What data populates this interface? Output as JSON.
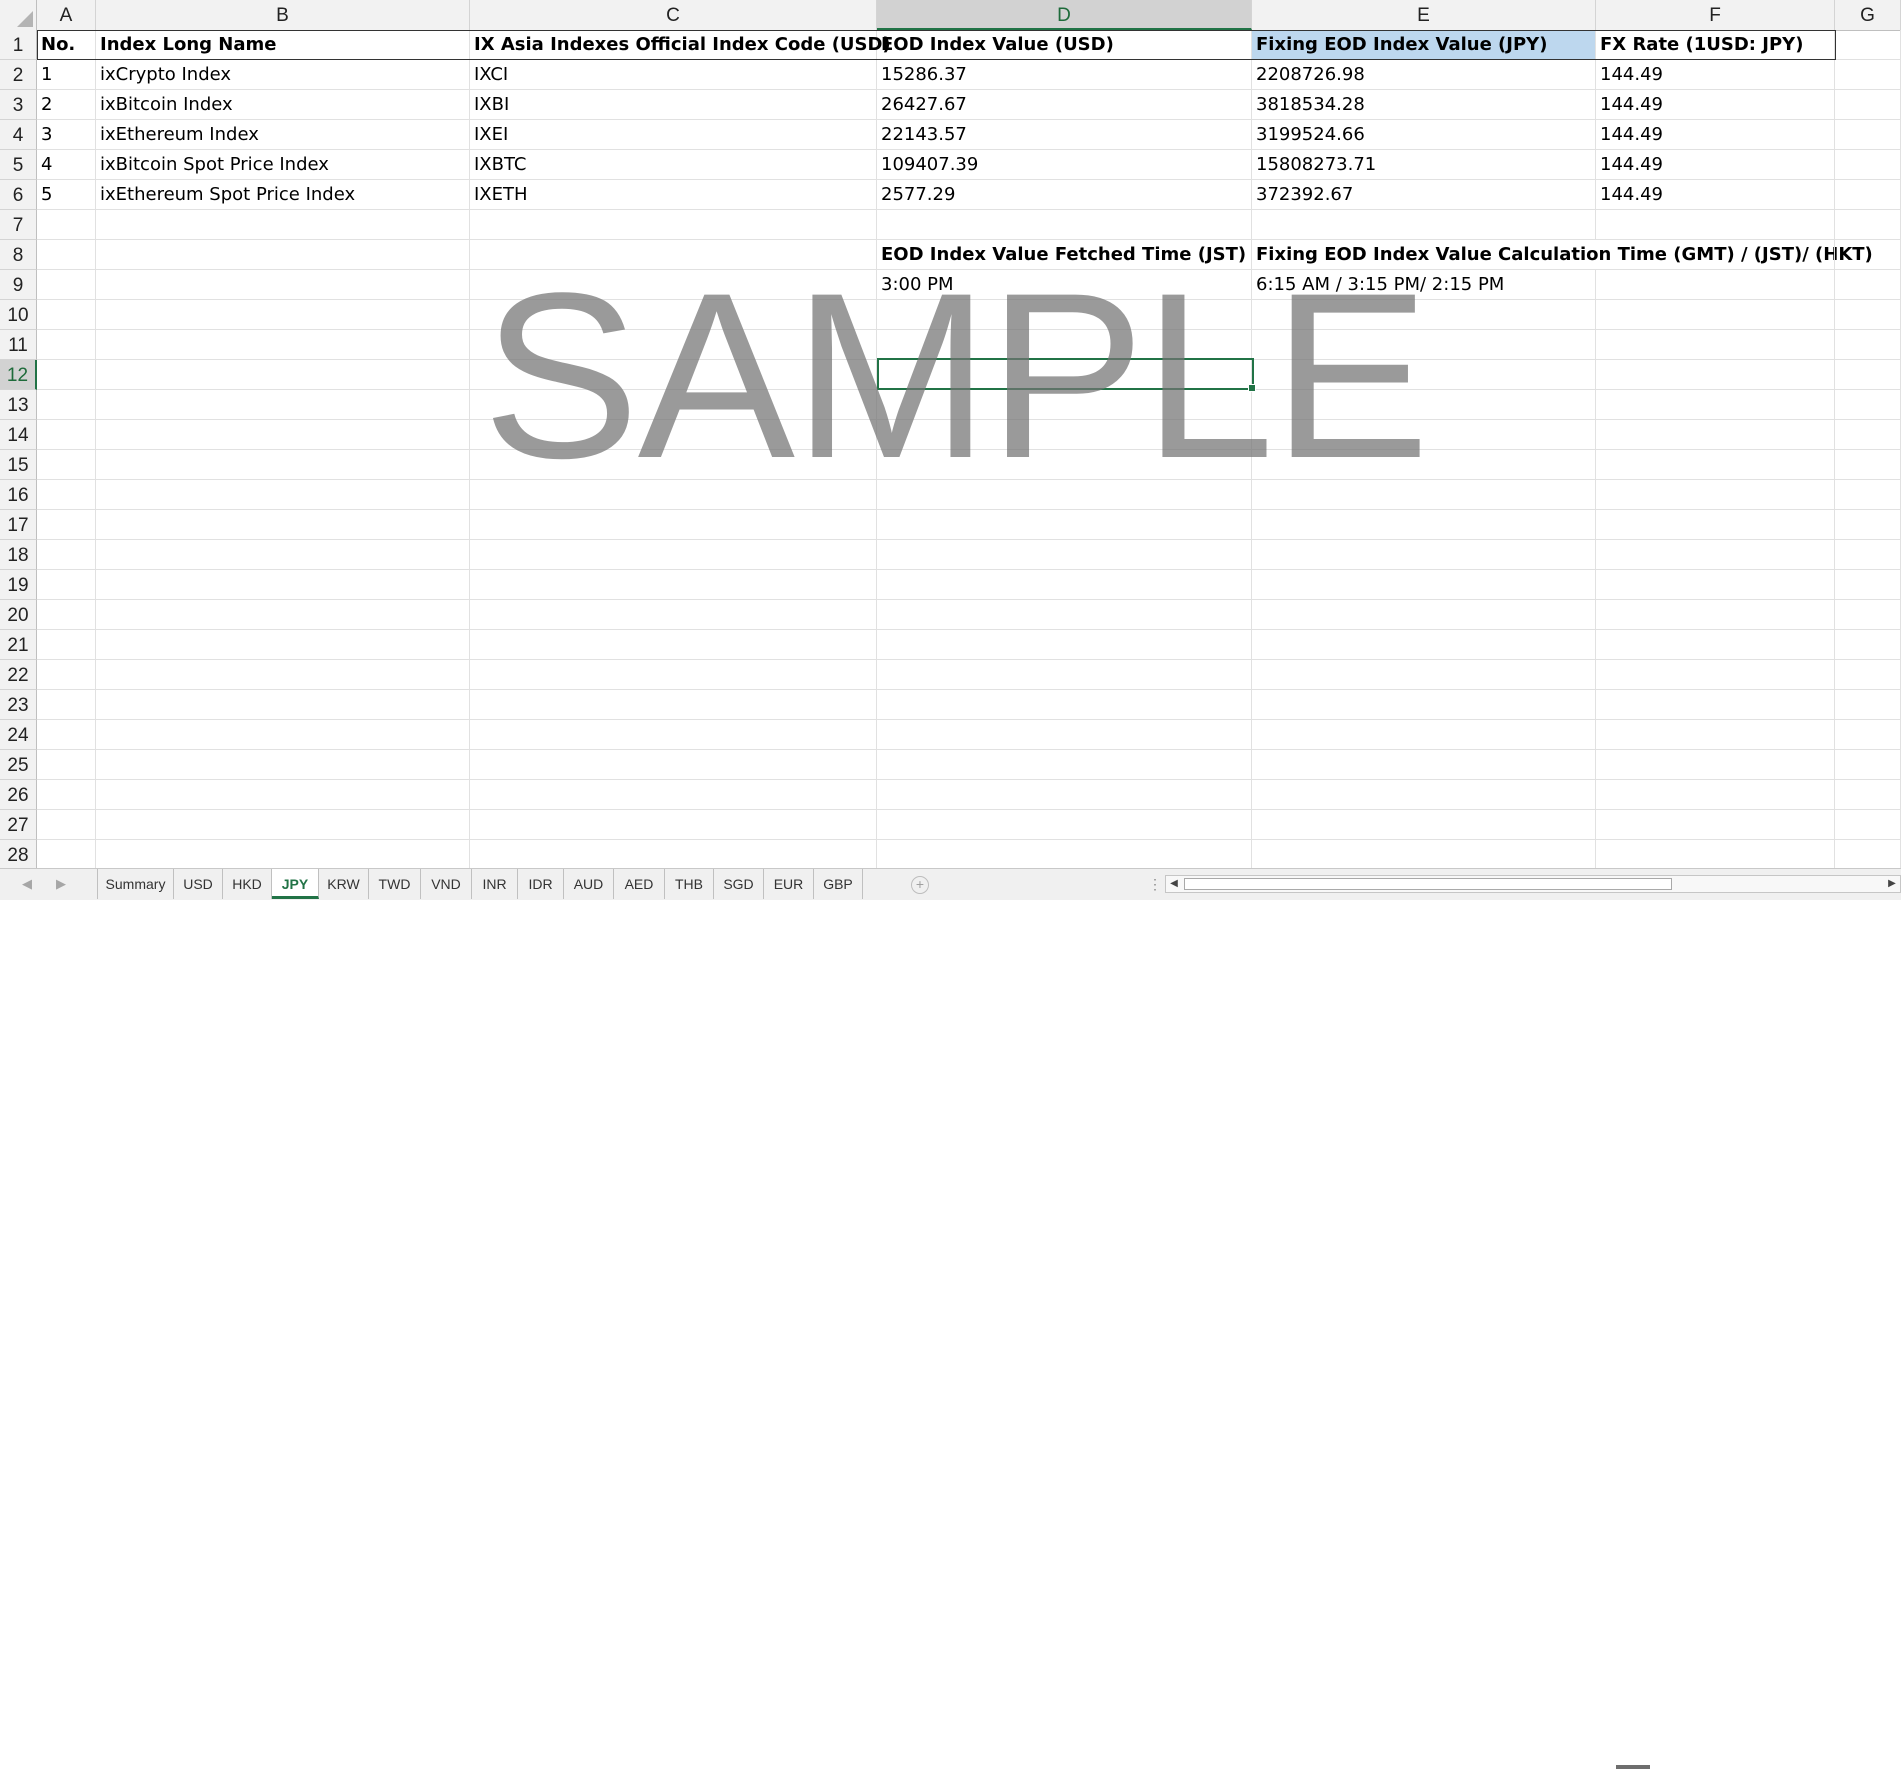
{
  "columns": [
    "A",
    "B",
    "C",
    "D",
    "E",
    "F",
    "G"
  ],
  "selected_column": "D",
  "rows": [
    "1",
    "2",
    "3",
    "4",
    "5",
    "6",
    "7",
    "8",
    "9",
    "10",
    "11",
    "12",
    "13",
    "14",
    "15",
    "16",
    "17",
    "18",
    "19",
    "20",
    "21",
    "22",
    "23",
    "24",
    "25",
    "26",
    "27",
    "28"
  ],
  "selected_row": "12",
  "header_row": {
    "A": "No.",
    "B": "Index Long Name",
    "C": "IX Asia Indexes Official Index Code (USD)",
    "D": "EOD Index Value (USD)",
    "E": "Fixing EOD Index Value (JPY)",
    "F": "FX Rate (1USD: JPY)"
  },
  "data_rows": [
    {
      "no": "1",
      "name": "ixCrypto Index",
      "code": "IXCI",
      "eod_usd": "15286.37",
      "fixing_jpy": "2208726.98",
      "fx": "144.49"
    },
    {
      "no": "2",
      "name": "ixBitcoin Index",
      "code": "IXBI",
      "eod_usd": "26427.67",
      "fixing_jpy": "3818534.28",
      "fx": "144.49"
    },
    {
      "no": "3",
      "name": "ixEthereum Index",
      "code": "IXEI",
      "eod_usd": "22143.57",
      "fixing_jpy": "3199524.66",
      "fx": "144.49"
    },
    {
      "no": "4",
      "name": "ixBitcoin Spot Price Index",
      "code": "IXBTC",
      "eod_usd": "109407.39",
      "fixing_jpy": "15808273.71",
      "fx": "144.49"
    },
    {
      "no": "5",
      "name": "ixEthereum Spot Price Index",
      "code": "IXETH",
      "eod_usd": "2577.29",
      "fixing_jpy": "372392.67",
      "fx": "144.49"
    }
  ],
  "time_labels": {
    "fetched_label": "EOD Index Value Fetched Time (JST)",
    "calc_label": "Fixing EOD Index Value Calculation Time (GMT) / (JST)/ (HKT)",
    "fetched_value": "3:00 PM",
    "calc_value": "6:15 AM / 3:15 PM/ 2:15 PM"
  },
  "watermark": "SAMPLE",
  "colors": {
    "accent": "#217346",
    "highlight": "#bdd7ee",
    "watermark": "#737373"
  },
  "sheet_tabs": [
    "Summary",
    "USD",
    "HKD",
    "JPY",
    "KRW",
    "TWD",
    "VND",
    "INR",
    "IDR",
    "AUD",
    "AED",
    "THB",
    "SGD",
    "EUR",
    "GBP"
  ],
  "active_tab": "JPY",
  "icons": {
    "prev_sheet": "◀",
    "next_sheet": "▶",
    "add_sheet": "+",
    "splitter": "⋮",
    "scroll_left": "◀",
    "scroll_right": "▶"
  }
}
